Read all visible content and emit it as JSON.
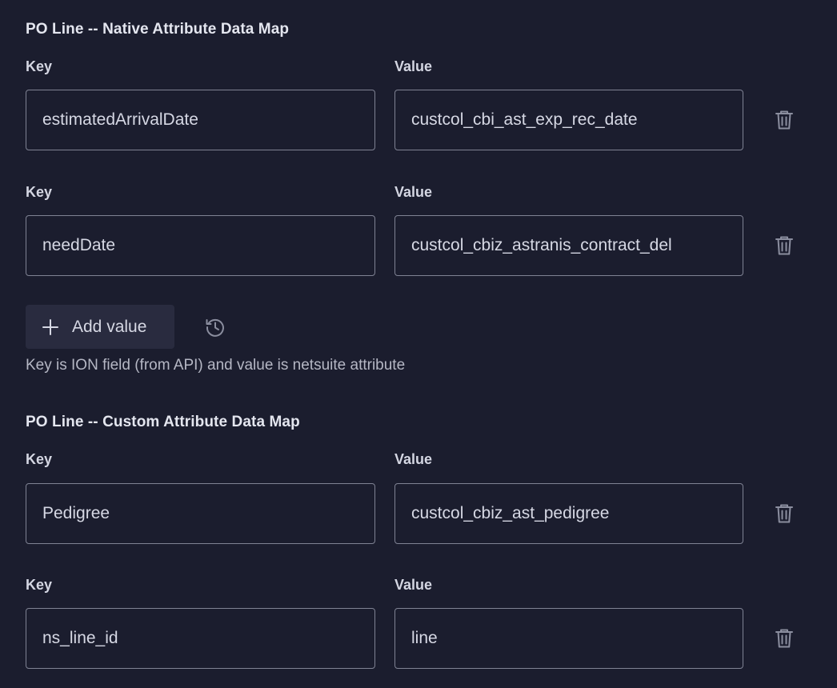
{
  "native_map": {
    "title": "PO Line -- Native Attribute Data Map",
    "rows": [
      {
        "key_label": "Key",
        "value_label": "Value",
        "key": "estimatedArrivalDate",
        "value": "custcol_cbi_ast_exp_rec_date"
      },
      {
        "key_label": "Key",
        "value_label": "Value",
        "key": "needDate",
        "value": "custcol_cbiz_astranis_contract_del"
      }
    ],
    "add_label": "Add value",
    "helper_text": "Key is ION field (from API) and value is netsuite attribute"
  },
  "custom_map": {
    "title": "PO Line -- Custom Attribute Data Map",
    "rows": [
      {
        "key_label": "Key",
        "value_label": "Value",
        "key": "Pedigree",
        "value": "custcol_cbiz_ast_pedigree"
      },
      {
        "key_label": "Key",
        "value_label": "Value",
        "key": "ns_line_id",
        "value": "line"
      }
    ]
  },
  "icons": {
    "delete": "trash-icon",
    "add": "plus-icon",
    "history": "history-icon"
  },
  "colors": {
    "background": "#1b1d2e",
    "input_border": "#7f8293",
    "button_bg": "#292b3f",
    "text": "#d6d8e4"
  }
}
